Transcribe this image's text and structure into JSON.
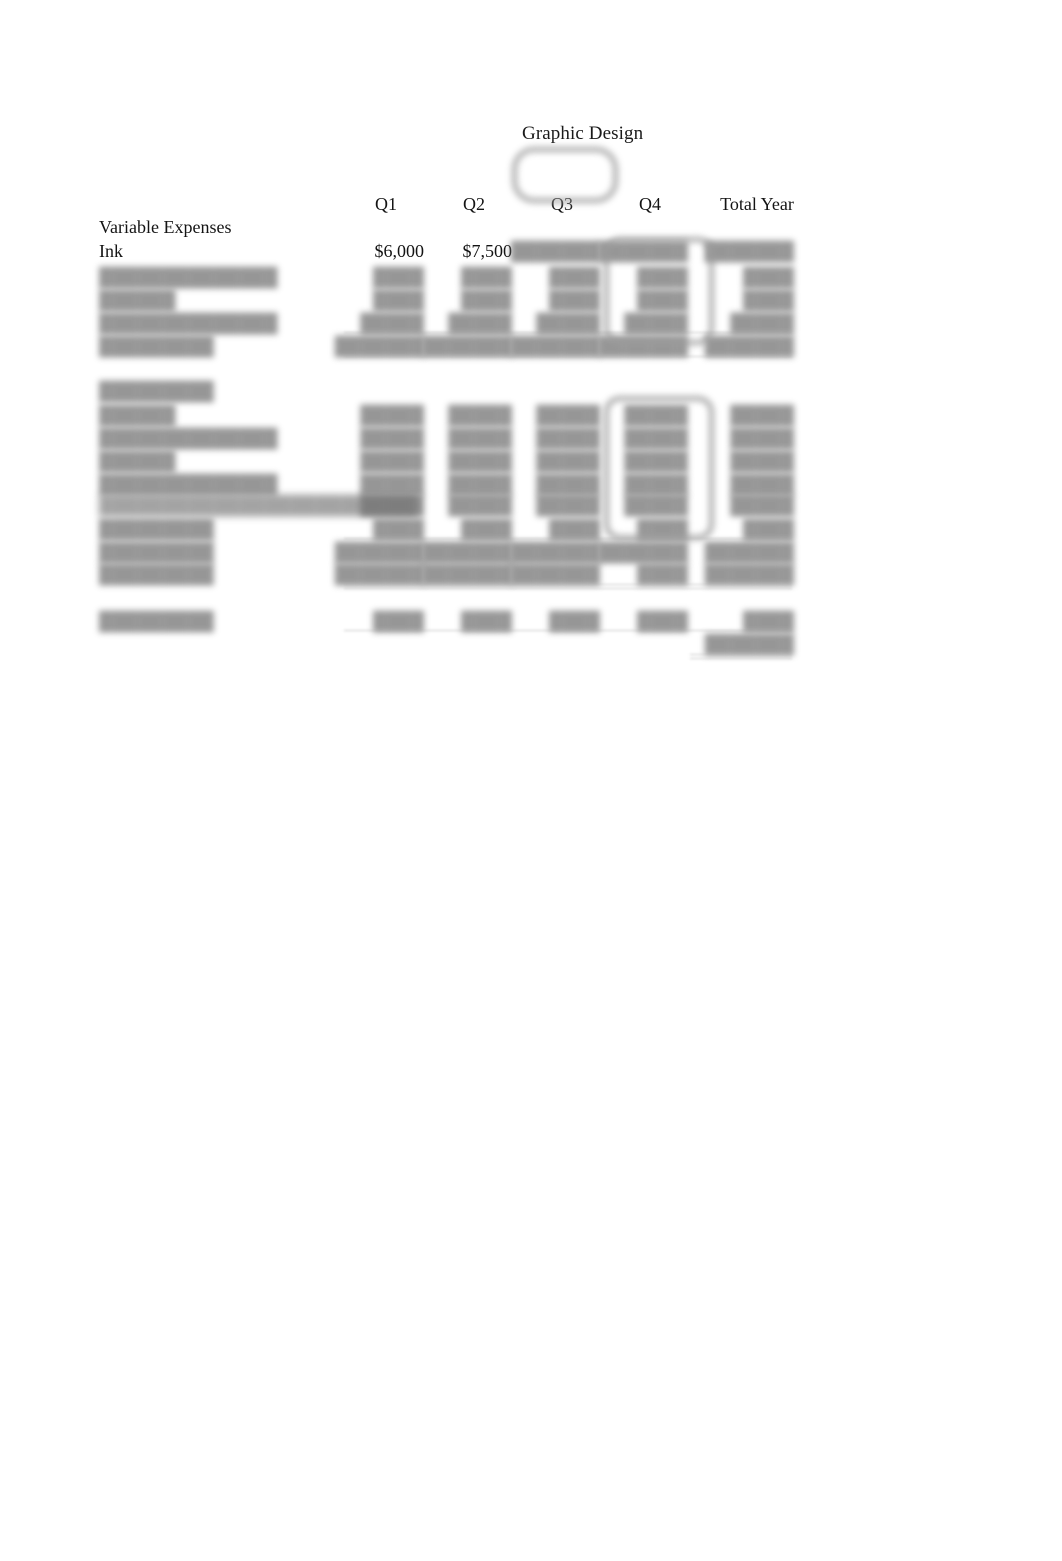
{
  "document": {
    "title": "Graphic Design",
    "type": "budget-worksheet"
  },
  "table": {
    "columns": [
      "Q1",
      "Q2",
      "Q3",
      "Q4",
      "Total Year"
    ],
    "sections": [
      {
        "heading": "Variable Expenses",
        "rows": [
          {
            "label": "Ink",
            "legible": true,
            "values": [
              "$6,000",
              "$7,500",
              "",
              "",
              ""
            ]
          },
          {
            "label": "",
            "legible": false,
            "values": [
              "",
              "",
              "",
              "",
              ""
            ]
          },
          {
            "label": "",
            "legible": false,
            "values": [
              "",
              "",
              "",
              "",
              ""
            ]
          },
          {
            "label": "",
            "legible": false,
            "values": [
              "",
              "",
              "",
              "",
              ""
            ]
          },
          {
            "label": "",
            "legible": false,
            "values": [
              "",
              "",
              "",
              "",
              ""
            ]
          }
        ]
      },
      {
        "heading": "",
        "rows": [
          {
            "label": "",
            "legible": false,
            "values": [
              "",
              "",
              "",
              "",
              ""
            ]
          },
          {
            "label": "",
            "legible": false,
            "values": [
              "",
              "",
              "",
              "",
              ""
            ]
          },
          {
            "label": "",
            "legible": false,
            "values": [
              "",
              "",
              "",
              "",
              ""
            ]
          },
          {
            "label": "",
            "legible": false,
            "values": [
              "",
              "",
              "",
              "",
              ""
            ]
          },
          {
            "label": "",
            "legible": false,
            "values": [
              "",
              "",
              "",
              "",
              ""
            ]
          },
          {
            "label": "",
            "legible": false,
            "values": [
              "",
              "",
              "",
              "",
              ""
            ]
          },
          {
            "label": "",
            "legible": false,
            "values": [
              "",
              "",
              "",
              "",
              ""
            ]
          },
          {
            "label": "",
            "legible": false,
            "values": [
              "",
              "",
              "",
              "",
              ""
            ]
          }
        ]
      },
      {
        "heading": "",
        "rows": [
          {
            "label": "",
            "legible": false,
            "values": [
              "",
              "",
              "",
              "",
              ""
            ]
          }
        ]
      }
    ]
  },
  "labels": {
    "variable_expenses": "Variable Expenses",
    "ink": "Ink",
    "q1": "Q1",
    "q2": "Q2",
    "q3": "Q3",
    "q4": "Q4",
    "total_year": "Total Year",
    "ink_q1": "$6,000",
    "ink_q2": "$7,500"
  },
  "obscured": {
    "note": "blurred",
    "placeholder_short": "██████",
    "placeholder_mid": "█████████",
    "placeholder_long": "██████████████",
    "placeholder_xlong": "█████████████████████████",
    "num_short": "████",
    "num_mid": "█████",
    "num_long": "███████"
  },
  "annotations": [
    {
      "name": "title-highlight",
      "shape": "rounded-rect",
      "target": "Graphic Design / Q3"
    },
    {
      "name": "q4-variable-box",
      "shape": "rounded-rect",
      "target": "Q4 variable expenses"
    },
    {
      "name": "q4-fixed-box",
      "shape": "rounded-rect",
      "target": "Q4 fixed expenses"
    }
  ],
  "colors": {
    "page_background": "#ffffff",
    "text": "#141414",
    "blurred_text": "#6f6f6f",
    "annotation_stroke": "#9c9c9c",
    "rule": "#9a9a9a"
  }
}
